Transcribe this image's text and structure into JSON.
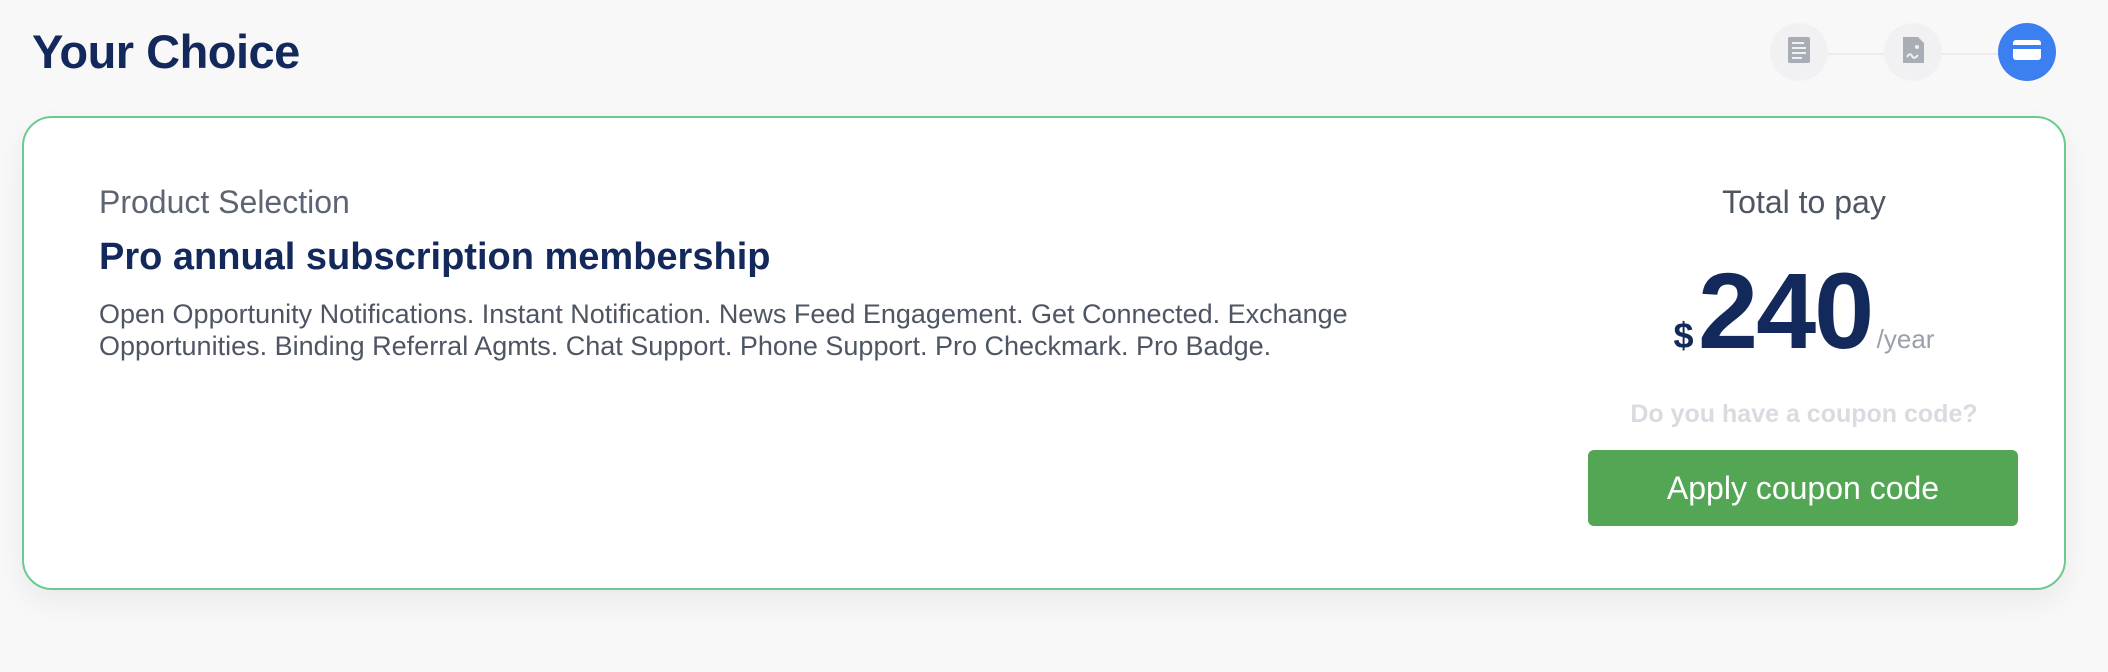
{
  "page": {
    "title": "Your Choice"
  },
  "stepper": {
    "steps": [
      {
        "icon": "document-icon",
        "state": "done"
      },
      {
        "icon": "signed-document-icon",
        "state": "done"
      },
      {
        "icon": "credit-card-icon",
        "state": "current"
      }
    ],
    "colors": {
      "active": "#3b7ff0",
      "inactive": "#f1f1f3"
    }
  },
  "product": {
    "label": "Product Selection",
    "name": "Pro annual subscription membership",
    "description": "Open Opportunity Notifications. Instant Notification. News Feed Engagement. Get Connected. Exchange Opportunities. Binding Referral Agmts. Chat Support. Phone Support. Pro Checkmark. Pro Badge."
  },
  "pricing": {
    "total_label": "Total to pay",
    "currency": "$",
    "amount": "240",
    "period": "/year",
    "coupon_question": "Do you have a coupon code?",
    "coupon_button": "Apply coupon code"
  },
  "colors": {
    "title": "#13295b",
    "card_border": "#6cc990",
    "button": "#53a754"
  }
}
